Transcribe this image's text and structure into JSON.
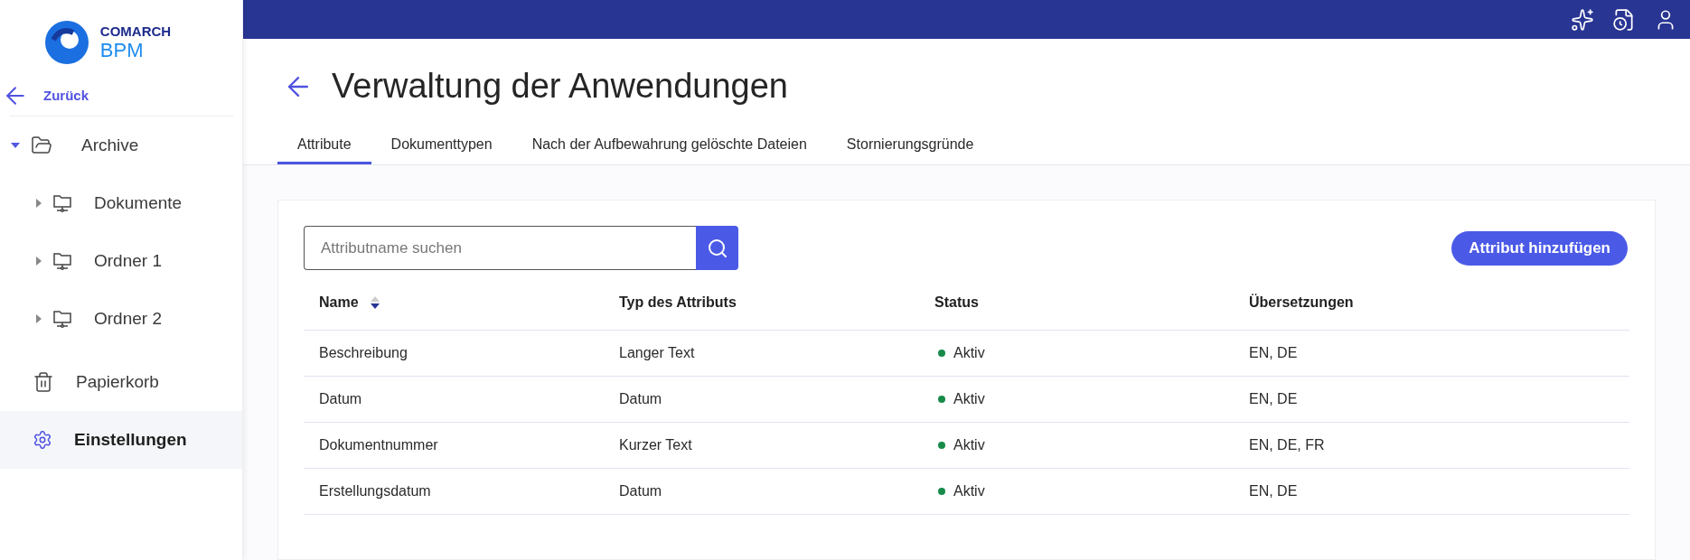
{
  "logo": {
    "brand": "COMARCH",
    "product": "BPM"
  },
  "sidebar": {
    "back": "Zurück",
    "tree": [
      {
        "label": "Archive",
        "kind": "folder",
        "expanded": true,
        "children": [
          {
            "label": "Dokumente",
            "kind": "network-folder",
            "expanded": false
          },
          {
            "label": "Ordner 1",
            "kind": "network-folder",
            "expanded": false
          },
          {
            "label": "Ordner 2",
            "kind": "network-folder",
            "expanded": false
          }
        ]
      }
    ],
    "items": [
      {
        "label": "Papierkorb",
        "kind": "trash",
        "selected": false
      },
      {
        "label": "Einstellungen",
        "kind": "settings",
        "selected": true
      }
    ]
  },
  "page": {
    "title": "Verwaltung der Anwendungen"
  },
  "tabs": [
    {
      "label": "Attribute",
      "selected": true
    },
    {
      "label": "Dokumenttypen",
      "selected": false
    },
    {
      "label": "Nach der Aufbewahrung gelöschte Dateien",
      "selected": false
    },
    {
      "label": "Stornierungsgründe",
      "selected": false
    }
  ],
  "search": {
    "placeholder": "Attributname suchen"
  },
  "add_button": "Attribut hinzufügen",
  "table": {
    "columns": [
      {
        "label": "Name",
        "sortable": true
      },
      {
        "label": "Typ des Attributs",
        "sortable": false
      },
      {
        "label": "Status",
        "sortable": false
      },
      {
        "label": "Übersetzungen",
        "sortable": false
      }
    ],
    "rows": [
      {
        "name": "Beschreibung",
        "type": "Langer Text",
        "status": "Aktiv",
        "color": "#188a4a",
        "translations": "EN, DE"
      },
      {
        "name": "Datum",
        "type": "Datum",
        "status": "Aktiv",
        "color": "#188a4a",
        "translations": "EN, DE"
      },
      {
        "name": "Dokumentnummer",
        "type": "Kurzer Text",
        "status": "Aktiv",
        "color": "#188a4a",
        "translations": "EN, DE, FR"
      },
      {
        "name": "Erstellungsdatum",
        "type": "Datum",
        "status": "Aktiv",
        "color": "#188a4a",
        "translations": "EN, DE"
      }
    ]
  }
}
